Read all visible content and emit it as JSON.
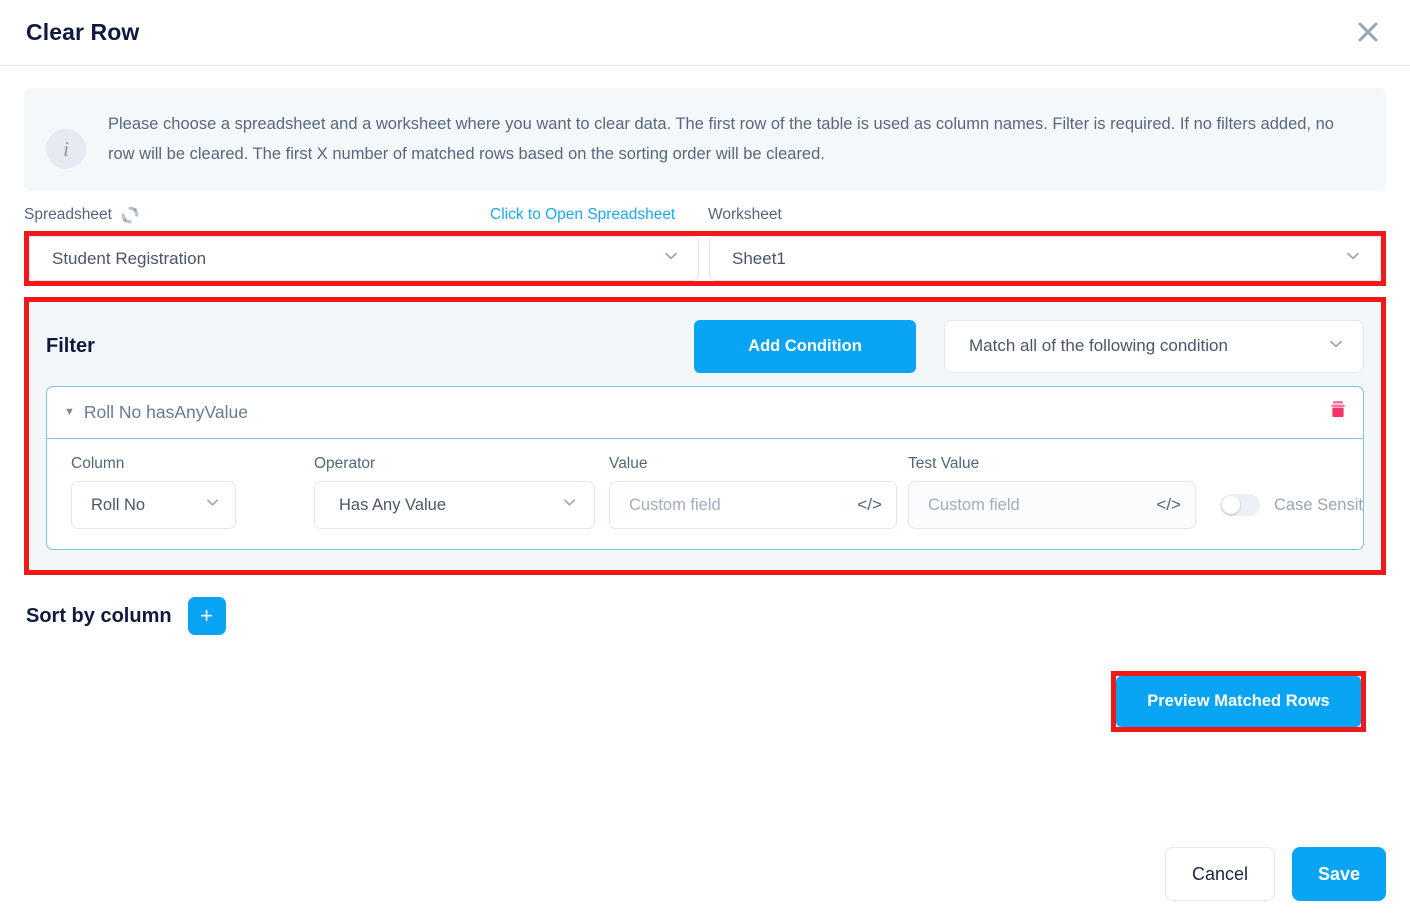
{
  "header": {
    "title": "Clear Row",
    "close_icon": "close-icon"
  },
  "info": {
    "icon": "info-icon",
    "text": "Please choose a spreadsheet and a worksheet where you want to clear data. The first row of the table is used as column names. Filter is required. If no filters added, no row will be cleared. The first X number of matched rows based on the sorting order will be cleared."
  },
  "spreadsheet": {
    "label": "Spreadsheet",
    "refresh_icon": "refresh-icon",
    "open_link": "Click to Open Spreadsheet",
    "value": "Student Registration",
    "chevron_icon": "chevron-down-icon"
  },
  "worksheet": {
    "label": "Worksheet",
    "value": "Sheet1",
    "chevron_icon": "chevron-down-icon"
  },
  "filter": {
    "title": "Filter",
    "add_condition_label": "Add Condition",
    "match_mode": "Match all of the following condition",
    "chevron_icon": "chevron-down-icon",
    "condition": {
      "caret_icon": "caret-down-icon",
      "summary": "Roll No hasAnyValue",
      "delete_icon": "trash-icon",
      "column_label": "Column",
      "column_value": "Roll No",
      "operator_label": "Operator",
      "operator_value": "Has Any Value",
      "value_label": "Value",
      "value_placeholder": "Custom field",
      "value_code_icon": "code-icon",
      "test_value_label": "Test Value",
      "test_value_placeholder": "Custom field",
      "test_value_code_icon": "code-icon",
      "case_sensitive_label": "Case Sensitive ?",
      "case_sensitive_state": "off"
    }
  },
  "sort": {
    "title": "Sort by column",
    "add_label": "+"
  },
  "preview": {
    "label": "Preview Matched Rows"
  },
  "footer": {
    "cancel_label": "Cancel",
    "save_label": "Save"
  },
  "colors": {
    "accent_blue": "#09a4f3",
    "link_blue": "#1ea7ef",
    "highlight_red": "#f01919",
    "delete_pink": "#f5336b",
    "panel_bg": "#f3f7fa",
    "info_bg": "#f5f8fb",
    "condition_border": "#7cc4e2"
  }
}
